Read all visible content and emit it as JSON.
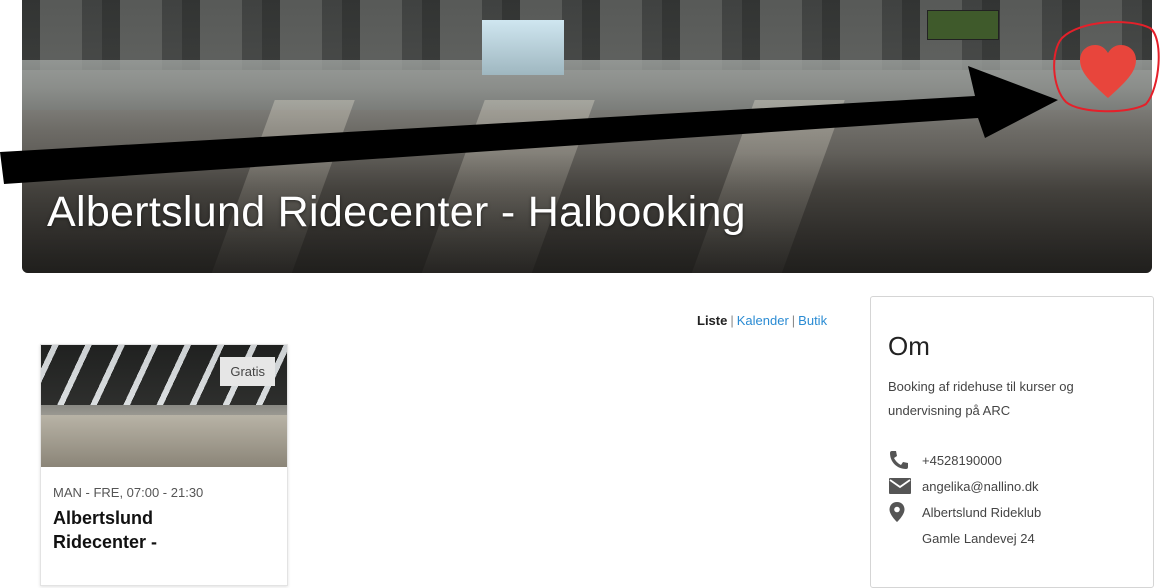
{
  "hero": {
    "title": "Albertslund Ridecenter - Halbooking",
    "favorite_icon": "heart-icon"
  },
  "view_switch": {
    "active": "Liste",
    "links": [
      "Kalender",
      "Butik"
    ],
    "separator": "|"
  },
  "event_card": {
    "badge": "Gratis",
    "schedule": "MAN - FRE, 07:00 - 21:30",
    "title": "Albertslund Ridecenter -"
  },
  "sidebar": {
    "heading": "Om",
    "description": "Booking af ridehuse til kurser og undervisning på ARC",
    "phone": "+4528190000",
    "email": "angelika@nallino.dk",
    "address_name": "Albertslund Rideklub",
    "address_street": "Gamle Landevej 24",
    "icons": [
      "phone-icon",
      "mail-icon",
      "location-pin-icon"
    ]
  },
  "colors": {
    "heart": "#e8453c",
    "annotation_circle": "#e5202a",
    "link": "#2a8bd3"
  }
}
